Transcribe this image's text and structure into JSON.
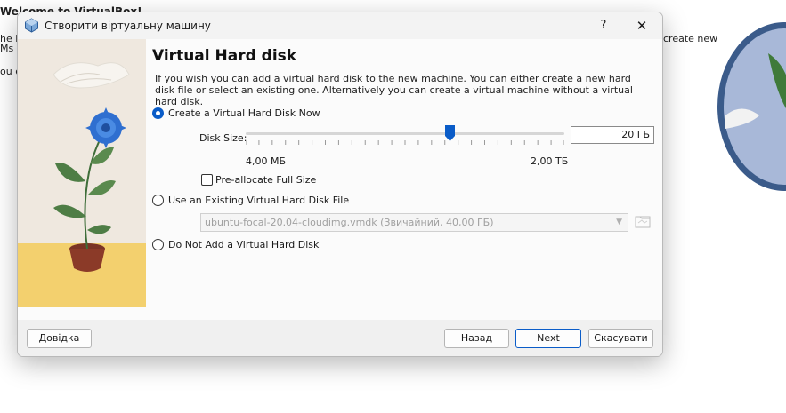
{
  "background": {
    "lines": [
      "Welcome to VirtualBox!",
      "he le",
      "Ms u",
      "ou c"
    ],
    "right_text": "create new"
  },
  "dialog": {
    "title": "Створити віртуальну машину",
    "help_label": "?",
    "close_label": "✕",
    "heading": "Virtual Hard disk",
    "description": "If you wish you can add a virtual hard disk to the new machine. You can either create a new hard disk file or select an existing one. Alternatively you can create a virtual machine without a virtual hard disk.",
    "options": {
      "create_now": {
        "label": "Create a Virtual Hard Disk Now",
        "checked": true
      },
      "use_existing": {
        "label": "Use an Existing Virtual Hard Disk File",
        "checked": false
      },
      "do_not_add": {
        "label": "Do Not Add a Virtual Hard Disk",
        "checked": false
      }
    },
    "disk_size": {
      "label": "Disk Size:",
      "value": "20 ГБ",
      "min_label": "4,00 МБ",
      "max_label": "2,00 ТБ",
      "slider_fraction": 0.64
    },
    "preallocate": {
      "label": "Pre-allocate Full Size",
      "checked": false
    },
    "existing_file": {
      "selected": "ubuntu-focal-20.04-cloudimg.vmdk (Звичайний, 40,00 ГБ)"
    },
    "buttons": {
      "help": "Довідка",
      "back": "Назад",
      "next": "Next",
      "cancel": "Скасувати"
    },
    "colors": {
      "accent": "#0a5cc8",
      "illustration_floor": "#f3d06e"
    }
  }
}
